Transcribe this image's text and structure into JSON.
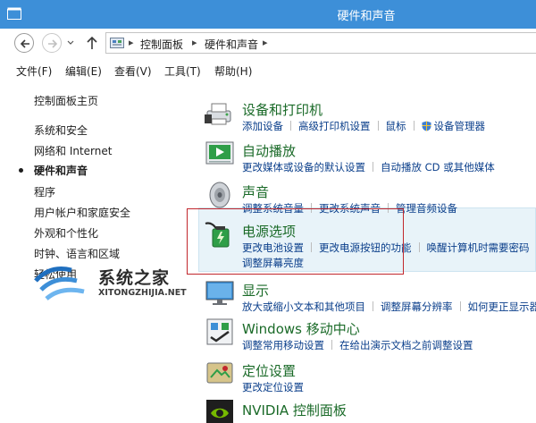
{
  "window": {
    "title": "硬件和声音"
  },
  "address": {
    "separator": "▸",
    "breadcrumbs": [
      "控制面板",
      "硬件和声音"
    ]
  },
  "menu": [
    "文件(F)",
    "编辑(E)",
    "查看(V)",
    "工具(T)",
    "帮助(H)"
  ],
  "sidebar": {
    "home": "控制面板主页",
    "items": [
      "系统和安全",
      "网络和 Internet",
      "硬件和声音",
      "程序",
      "用户帐户和家庭安全",
      "外观和个性化",
      "时钟、语言和区域",
      "轻松使用"
    ],
    "active": "硬件和声音"
  },
  "categories": [
    {
      "title": "设备和打印机",
      "icon": "printer-icon",
      "links": [
        "添加设备",
        "高级打印机设置",
        "鼠标",
        "设备管理器"
      ]
    },
    {
      "title": "自动播放",
      "icon": "autoplay-icon",
      "links": [
        "更改媒体或设备的默认设置",
        "自动播放 CD 或其他媒体"
      ]
    },
    {
      "title": "声音",
      "icon": "speaker-icon",
      "links": [
        "调整系统音量",
        "更改系统声音",
        "管理音频设备"
      ]
    },
    {
      "title": "电源选项",
      "icon": "battery-icon",
      "links": [
        "更改电池设置",
        "更改电源按钮的功能",
        "唤醒计算机时需要密码"
      ],
      "links2": [
        "调整屏幕亮度"
      ]
    },
    {
      "title": "显示",
      "icon": "monitor-icon",
      "links": [
        "放大或缩小文本和其他项目",
        "调整屏幕分辨率",
        "如何更正显示器闪烁"
      ]
    },
    {
      "title": "Windows 移动中心",
      "icon": "mobility-center-icon",
      "links": [
        "调整常用移动设置",
        "在给出演示文档之前调整设置"
      ]
    },
    {
      "title": "定位设置",
      "icon": "location-icon",
      "links": [
        "更改定位设置"
      ]
    },
    {
      "title": "NVIDIA 控制面板",
      "icon": "nvidia-icon",
      "links": []
    }
  ],
  "watermark": {
    "text": "系统之家",
    "sub": "XITONGZHIJIA.NET"
  },
  "colors": {
    "titlebar": "#3d8fd8",
    "category_title": "#1a6a28",
    "link": "#0b3f8b",
    "highlight": "#e8f3f9",
    "annotation": "#c1272d"
  }
}
